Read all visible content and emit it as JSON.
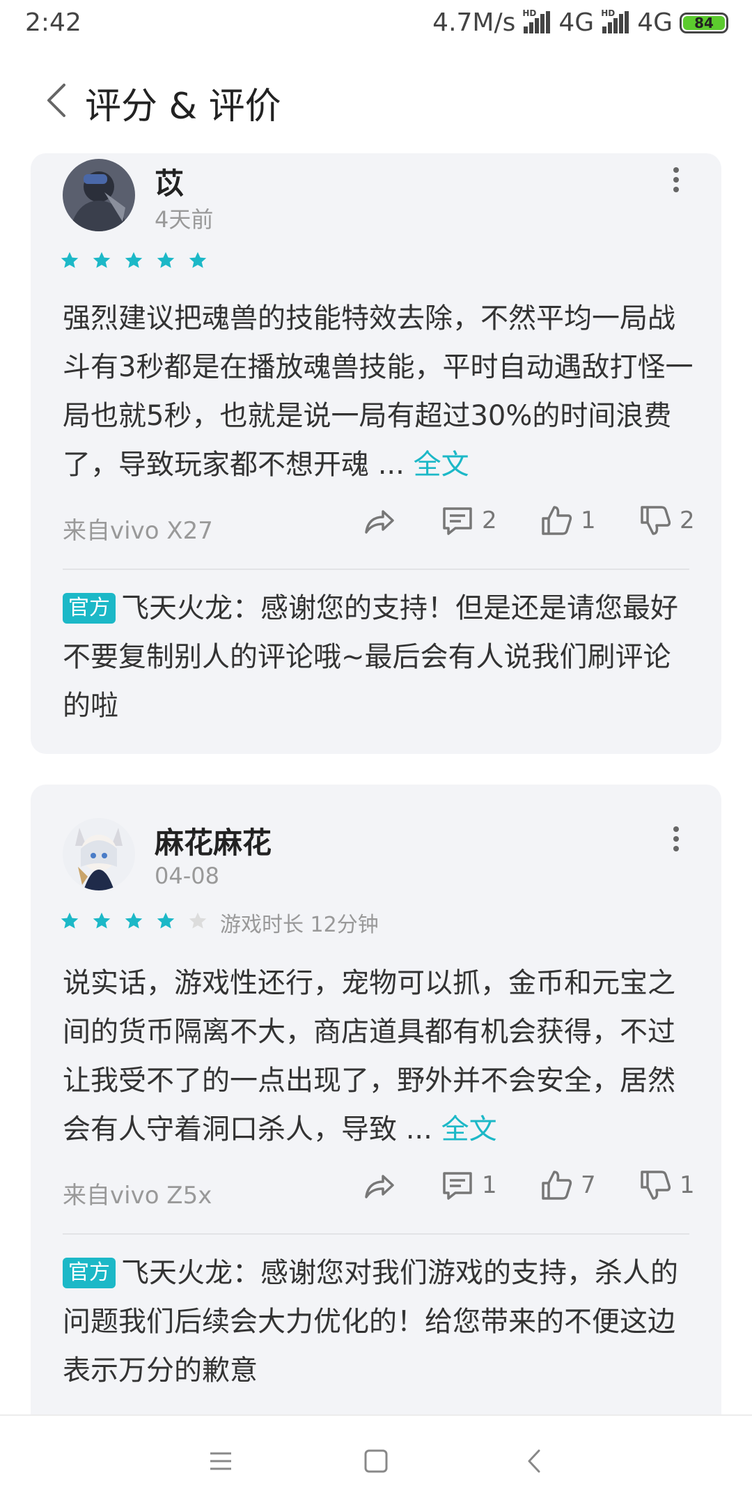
{
  "status_bar": {
    "time": "2:42",
    "speed": "4.7M/s",
    "network1": "4G",
    "network2": "4G",
    "battery": "84"
  },
  "header": {
    "title": "评分 & 评价"
  },
  "reviews": [
    {
      "author": "苡",
      "date": "4天前",
      "rating": 5,
      "playtime": "",
      "content": "强烈建议把魂兽的技能特效去除，不然平均一局战斗有3秒都是在播放魂兽技能，平时自动遇敌打怪一局也就5秒，也就是说一局有超过30%的时间浪费了，导致玩家都不想开魂 ... ",
      "full_text_link": "全文",
      "device": "来自vivo X27",
      "comments": "2",
      "likes": "1",
      "dislikes": "2",
      "reply": {
        "badge": "官方",
        "text": "飞天火龙：感谢您的支持！但是还是请您最好不要复制别人的评论哦~最后会有人说我们刷评论的啦"
      }
    },
    {
      "author": "麻花麻花",
      "date": "04-08",
      "rating": 4,
      "playtime": "游戏时长 12分钟",
      "content": "说实话，游戏性还行，宠物可以抓，金币和元宝之间的货币隔离不大，商店道具都有机会获得，不过让我受不了的一点出现了，野外并不会安全，居然会有人守着洞口杀人，导致 ... ",
      "full_text_link": "全文",
      "device": "来自vivo Z5x",
      "comments": "1",
      "likes": "7",
      "dislikes": "1",
      "reply": {
        "badge": "官方",
        "text": "飞天火龙：感谢您对我们游戏的支持，杀人的问题我们后续会大力优化的！给您带来的不便这边表示万分的歉意"
      }
    }
  ],
  "colors": {
    "accent": "#1cb8c7",
    "card_bg": "#f3f4f7",
    "star_on": "#1cb8c7",
    "star_off": "#dcdcdc"
  }
}
